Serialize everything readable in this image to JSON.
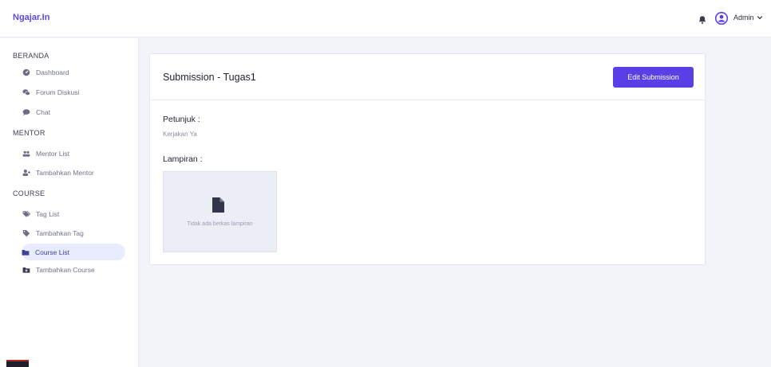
{
  "header": {
    "brand": "Ngajar.In",
    "user_label": "Admin"
  },
  "sidebar": {
    "sections": [
      {
        "title": "BERANDA",
        "items": [
          {
            "label": "Dashboard",
            "icon": "dashboard-icon"
          },
          {
            "label": "Forum Diskusi",
            "icon": "comments-icon"
          },
          {
            "label": "Chat",
            "icon": "chat-icon"
          }
        ]
      },
      {
        "title": "MENTOR",
        "items": [
          {
            "label": "Mentor List",
            "icon": "users-icon"
          },
          {
            "label": "Tambahkan Mentor",
            "icon": "user-plus-icon"
          }
        ]
      },
      {
        "title": "COURSE",
        "items": [
          {
            "label": "Tag List",
            "icon": "tags-icon"
          },
          {
            "label": "Tambahkan Tag",
            "icon": "tag-icon"
          },
          {
            "label": "Course List",
            "icon": "folder-icon",
            "active": true
          },
          {
            "label": "Tambahkan Course",
            "icon": "folder-plus-icon"
          }
        ]
      }
    ]
  },
  "main": {
    "title": "Submission - Tugas1",
    "edit_button": "Edit Submission",
    "instructions_label": "Petunjuk :",
    "instructions_text": "Kerjakan Ya",
    "attachment_label": "Lampiran :",
    "attachment_empty": "Tidak ada berkas lampiran"
  },
  "colors": {
    "brand": "#5a48e8",
    "primary_button": "#5b3fe6",
    "active_nav_bg": "#e9ecff",
    "page_bg": "#f1f3f9"
  }
}
